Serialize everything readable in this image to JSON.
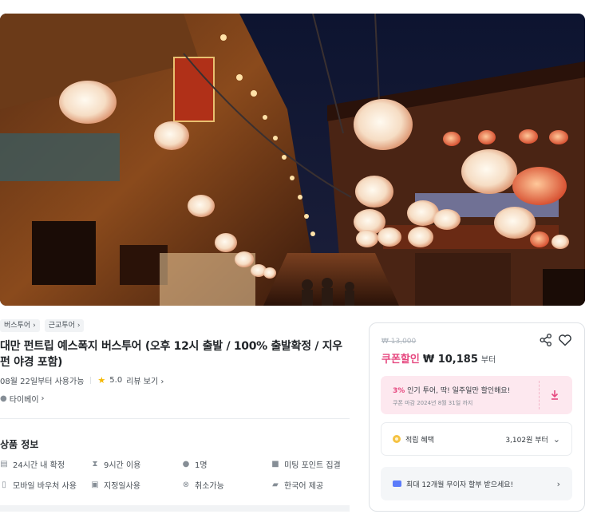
{
  "hero": {
    "alt_theme": "lantern-street-night"
  },
  "breadcrumbs": [
    {
      "label": "버스투어"
    },
    {
      "label": "근교투어"
    }
  ],
  "product": {
    "title": "대만 펀트립 예스폭지 버스투어 (오후 12시 출발 / 100% 출발확정 / 지우펀 야경 포함)",
    "available_from": "08월 22일부터 사용가능",
    "rating": "5.0",
    "reviews_link": "리뷰 보기",
    "location": "타이베이"
  },
  "info": {
    "title": "상품 정보",
    "items": [
      {
        "icon": "calendar-icon",
        "label": "24시간 내 확정"
      },
      {
        "icon": "hourglass-icon",
        "label": "9시간 이용"
      },
      {
        "icon": "person-icon",
        "label": "1명"
      },
      {
        "icon": "bus-icon",
        "label": "미팅 포인트 집결"
      },
      {
        "icon": "phone-icon",
        "label": "모바일 바우처 사용"
      },
      {
        "icon": "calendar-check-icon",
        "label": "지정일사용"
      },
      {
        "icon": "cancel-icon",
        "label": "취소가능"
      },
      {
        "icon": "language-icon",
        "label": "한국어 제공"
      }
    ]
  },
  "price_card": {
    "original_price": "₩ 13,000",
    "coupon_label": "쿠폰할인",
    "price": "₩ 10,185",
    "price_suffix": "부터",
    "promo_rate": "3%",
    "promo_text": "인기 투어, 딱! 일주일만 할인해요!",
    "promo_sub": "쿠폰 마감 2024년 8월 31일 까지",
    "reward_label": "적립 혜택",
    "reward_value": "3,102원 부터",
    "installment_label": "최대 12개월 무이자 할부 받으세요!"
  },
  "colors": {
    "accent": "#e64980",
    "promo_bg": "#fde8ef"
  }
}
